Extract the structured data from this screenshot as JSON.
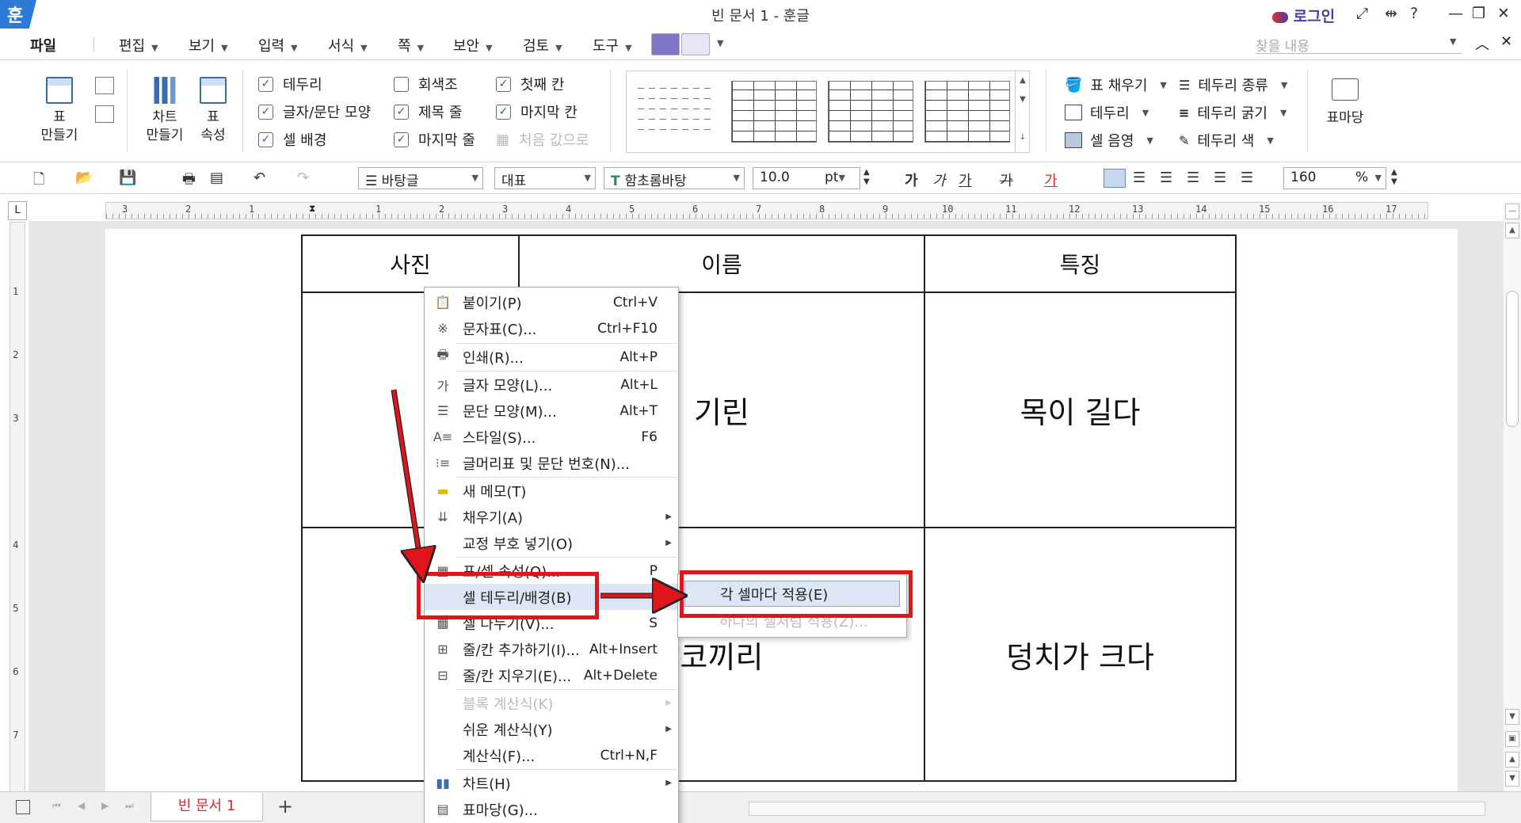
{
  "window": {
    "app_logo": "훈",
    "title": "빈 문서 1 - 훈글",
    "login": "로그인",
    "help": "?"
  },
  "menubar": {
    "items": [
      "파일",
      "편집",
      "보기",
      "입력",
      "서식",
      "쪽",
      "보안",
      "검토",
      "도구"
    ],
    "search_placeholder": "찾을 내용"
  },
  "ribbon": {
    "make_table": "표\n만들기",
    "make_chart": "차트\n만들기",
    "table_props": "표\n속성",
    "checks": [
      {
        "label": "테두리",
        "checked": true
      },
      {
        "label": "글자/문단 모양",
        "checked": true
      },
      {
        "label": "셀 배경",
        "checked": true
      },
      {
        "label": "회색조",
        "checked": false
      },
      {
        "label": "제목 줄",
        "checked": true
      },
      {
        "label": "마지막 줄",
        "checked": true
      },
      {
        "label": "첫째 칸",
        "checked": true
      },
      {
        "label": "마지막 칸",
        "checked": true
      },
      {
        "label": "처음 값으로",
        "checked": false,
        "disabled": true
      }
    ],
    "right_items": [
      "표 채우기",
      "테두리",
      "셀 음영",
      "테두리 종류",
      "테두리 굵기",
      "테두리 색"
    ],
    "table_madang": "표마당"
  },
  "fmtbar": {
    "style": "바탕글",
    "lang": "대표",
    "font": "함초롬바탕",
    "size": "10.0",
    "size_unit": "pt",
    "zoom": "160",
    "zoom_unit": "%",
    "char_buttons": [
      "가",
      "가",
      "가",
      "가",
      "가"
    ]
  },
  "ruler": {
    "h_numbers": [
      "3",
      "2",
      "1",
      "",
      "1",
      "2",
      "3",
      "4",
      "5",
      "6",
      "7",
      "8",
      "9",
      "10",
      "11",
      "12",
      "13",
      "14",
      "15",
      "16",
      "17"
    ],
    "v_numbers": [
      "1",
      "2",
      "3",
      "4",
      "5",
      "6",
      "7"
    ]
  },
  "table": {
    "headers": [
      "사진",
      "이름",
      "특징"
    ],
    "rows": [
      [
        "",
        "기린",
        "목이 길다"
      ],
      [
        "",
        "코끼리",
        "덩치가 크다"
      ]
    ]
  },
  "context_menu": {
    "items": [
      {
        "label": "붙이기(P)",
        "shortcut": "Ctrl+V",
        "icon": "clipboard-icon"
      },
      {
        "label": "문자표(C)...",
        "shortcut": "Ctrl+F10",
        "icon": "symbol-icon"
      },
      {
        "label": "인쇄(R)...",
        "shortcut": "Alt+P",
        "icon": "printer-icon"
      },
      {
        "label": "글자 모양(L)...",
        "shortcut": "Alt+L",
        "icon": "char-shape-icon"
      },
      {
        "label": "문단 모양(M)...",
        "shortcut": "Alt+T",
        "icon": "para-shape-icon"
      },
      {
        "label": "스타일(S)...",
        "shortcut": "F6",
        "icon": "style-icon"
      },
      {
        "label": "글머리표 및 문단 번호(N)...",
        "shortcut": "",
        "icon": "bullet-icon"
      },
      {
        "label": "새 메모(T)",
        "shortcut": "",
        "icon": "memo-icon"
      },
      {
        "label": "채우기(A)",
        "shortcut": "",
        "icon": "fill-icon",
        "submenu": true
      },
      {
        "label": "교정 부호 넣기(O)",
        "shortcut": "",
        "icon": "",
        "submenu": true
      },
      {
        "label": "표/셀 속성(Q)...",
        "shortcut": "P",
        "icon": "table-icon"
      },
      {
        "label": "셀 테두리/배경(B)",
        "shortcut": "",
        "icon": "",
        "highlighted": true
      },
      {
        "label": "셀 나누기(V)...",
        "shortcut": "S",
        "icon": "split-cell-icon"
      },
      {
        "label": "줄/칸 추가하기(I)...",
        "shortcut": "Alt+Insert",
        "icon": "add-row-icon"
      },
      {
        "label": "줄/칸 지우기(E)...",
        "shortcut": "Alt+Delete",
        "icon": "delete-row-icon"
      },
      {
        "label": "블록 계산식(K)",
        "shortcut": "",
        "icon": "",
        "submenu": true,
        "disabled": true
      },
      {
        "label": "쉬운 계산식(Y)",
        "shortcut": "",
        "icon": "",
        "submenu": true
      },
      {
        "label": "계산식(F)...",
        "shortcut": "Ctrl+N,F",
        "icon": ""
      },
      {
        "label": "차트(H)",
        "shortcut": "",
        "icon": "chart-icon",
        "submenu": true
      },
      {
        "label": "표마당(G)...",
        "shortcut": "",
        "icon": "table-madang-icon"
      }
    ]
  },
  "submenu": {
    "items": [
      {
        "label": "각 셀마다 적용(E)",
        "highlighted": true
      },
      {
        "label": "하나의 셀처럼 적용(Z)...",
        "disabled": true
      }
    ]
  },
  "bottom": {
    "doc_tab": "빈 문서 1",
    "add_tab": "+"
  },
  "colors": {
    "accent": "#2d7bd8",
    "annotation_red": "#e0141b",
    "highlight": "#dce6f5",
    "tab_red": "#d0302f"
  }
}
